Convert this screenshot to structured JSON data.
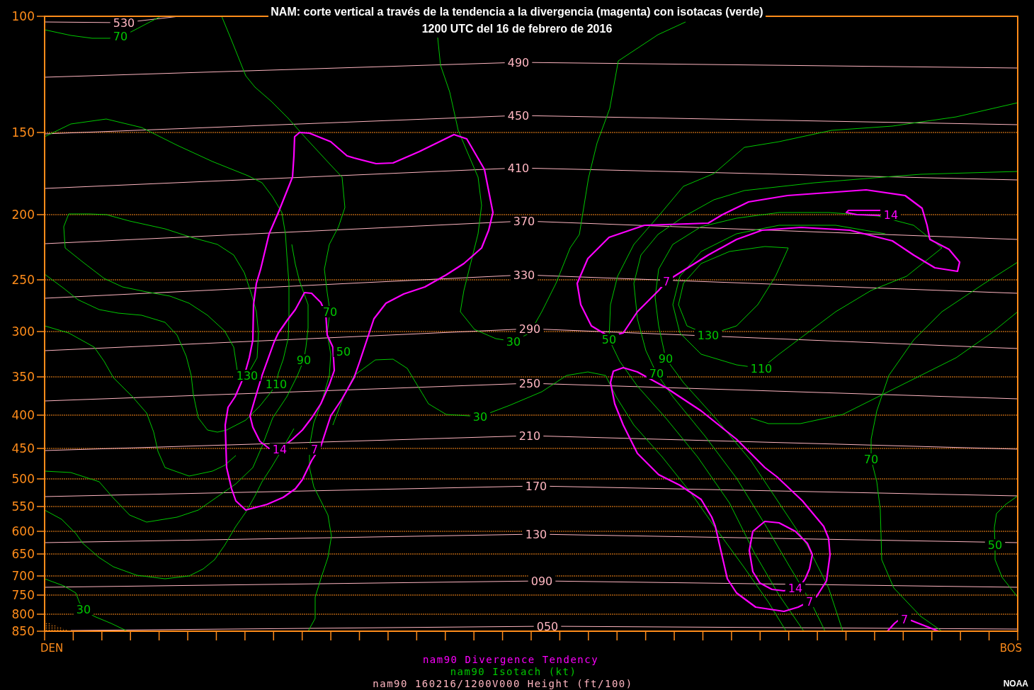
{
  "title": {
    "lines": [
      "NAM: corte vertical a través de la tendencia a la divergencia (magenta) con isotacas (verde)",
      "1200 UTC del 16 de febrero de 2016"
    ]
  },
  "plot": {
    "y_axis": {
      "labels": [
        "100",
        "150",
        "200",
        "250",
        "300",
        "350",
        "400",
        "450",
        "500",
        "550",
        "600",
        "650",
        "700",
        "750",
        "800",
        "850"
      ]
    },
    "x_axis": {
      "start": "DEN",
      "end": "BOS"
    },
    "series": [
      {
        "kind": "divergence",
        "color": "#ff00ff",
        "legend": "nam90 Divergence Tendency",
        "contour_labels": [
          "14",
          "7",
          "14",
          "7",
          "14",
          "7",
          "7"
        ]
      },
      {
        "kind": "isotach",
        "color": "#00c800",
        "legend": "nam90 Isotach (kt)",
        "contour_labels": [
          "70",
          "70",
          "30",
          "50",
          "130",
          "50",
          "90",
          "90",
          "130",
          "70",
          "110",
          "110",
          "30",
          "70",
          "50",
          "30"
        ]
      },
      {
        "kind": "height",
        "color": "#ffb6c1",
        "legend": "nam90 160216/1200V000 Height (ft/100)",
        "contour_labels": [
          "530",
          "490",
          "450",
          "410",
          "370",
          "330",
          "290",
          "250",
          "210",
          "170",
          "130",
          "090",
          "050"
        ]
      }
    ]
  },
  "credit": "NOAA"
}
